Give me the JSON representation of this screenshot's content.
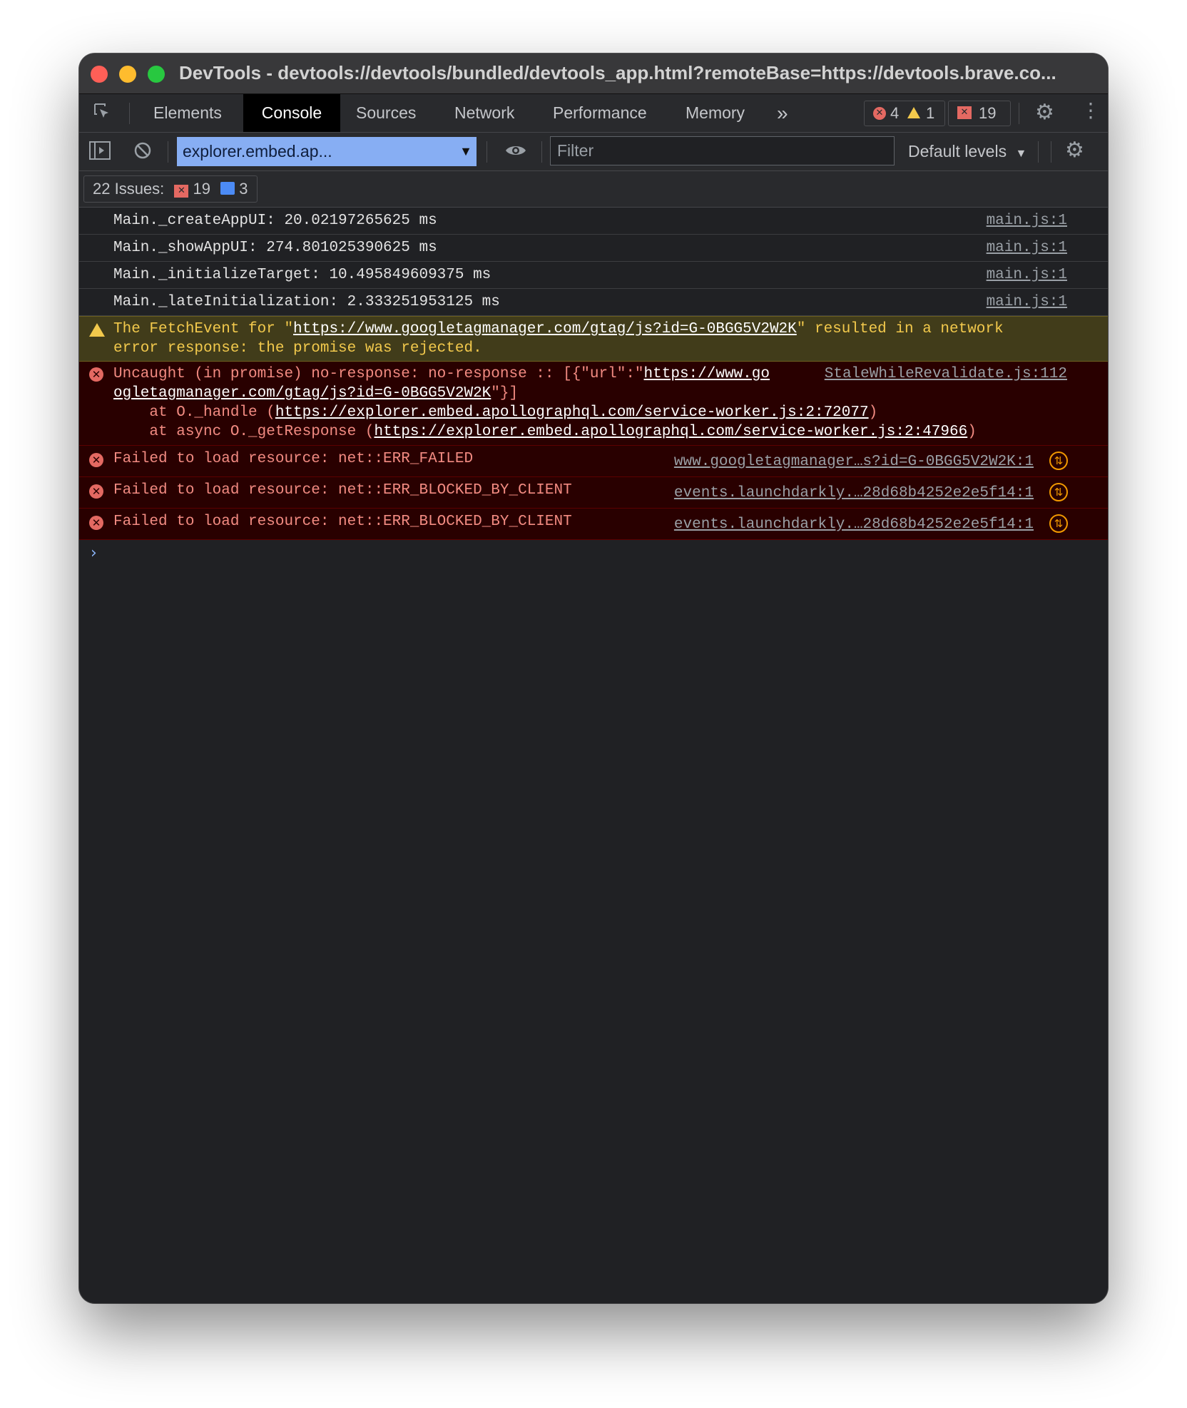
{
  "window": {
    "title": "DevTools - devtools://devtools/bundled/devtools_app.html?remoteBase=https://devtools.brave.co..."
  },
  "tabs": [
    {
      "label": "Elements"
    },
    {
      "label": "Console"
    },
    {
      "label": "Sources"
    },
    {
      "label": "Network"
    },
    {
      "label": "Performance"
    },
    {
      "label": "Memory"
    }
  ],
  "more_tabs_label": "»",
  "counters": {
    "errors": "4",
    "warnings": "1",
    "issues": "19"
  },
  "toolbar": {
    "context": "explorer.embed.ap...",
    "filter_placeholder": "Filter",
    "levels": "Default levels"
  },
  "issues_bar": {
    "label": "22 Issues:",
    "errors": "19",
    "info": "3"
  },
  "log": {
    "info": [
      {
        "message": "Main._createAppUI: 20.02197265625 ms",
        "source": "main.js:1"
      },
      {
        "message": "Main._showAppUI: 274.801025390625 ms",
        "source": "main.js:1"
      },
      {
        "message": "Main._initializeTarget: 10.495849609375 ms",
        "source": "main.js:1"
      },
      {
        "message": "Main._lateInitialization: 2.333251953125 ms",
        "source": "main.js:1"
      }
    ],
    "warning": {
      "pre": "The FetchEvent for \"",
      "link": "https://www.googletagmanager.com/gtag/js?id=G-0BGG5V2W2K",
      "post": "\" resulted in a network",
      "line2": "error response: the promise was rejected."
    },
    "uncaught": {
      "pre": "Uncaught (in promise) no-response: no-response :: [{\"url\":\"",
      "link1": "https://www.go",
      "source": "StaleWhileRevalidate.js:112",
      "link2": "ogletagmanager.com/gtag/js?id=G-0BGG5V2W2K",
      "post2": "\"}]",
      "stack1_pre": "    at O._handle (",
      "stack1_link": "https://explorer.embed.apollographql.com/service-worker.js:2:72077",
      "stack1_post": ")",
      "stack2_pre": "    at async O._getResponse (",
      "stack2_link": "https://explorer.embed.apollographql.com/service-worker.js:2:47966",
      "stack2_post": ")"
    },
    "failed": [
      {
        "message": "Failed to load resource: net::ERR_FAILED",
        "source": "www.googletagmanager…s?id=G-0BGG5V2W2K:1"
      },
      {
        "message": "Failed to load resource: net::ERR_BLOCKED_BY_CLIENT",
        "source": "events.launchdarkly.…28d68b4252e2e5f14:1"
      },
      {
        "message": "Failed to load resource: net::ERR_BLOCKED_BY_CLIENT",
        "source": "events.launchdarkly.…28d68b4252e2e5f14:1"
      }
    ],
    "prompt": "›"
  }
}
